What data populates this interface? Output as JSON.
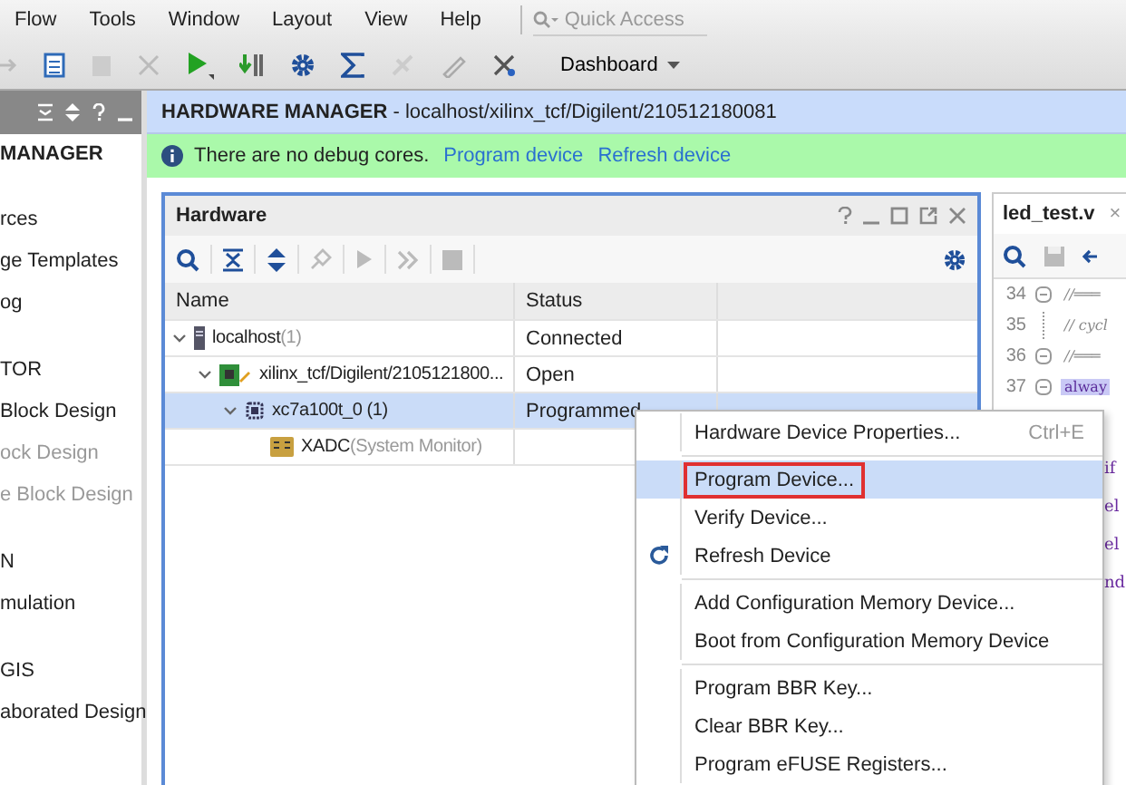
{
  "menu_bar": {
    "items": [
      "Flow",
      "Tools",
      "Window",
      "Layout",
      "View",
      "Help"
    ],
    "search": {
      "placeholder": "Quick Access"
    }
  },
  "toolbar": {
    "layout_dropdown": "Dashboard"
  },
  "flow_navigator": {
    "items": [
      {
        "label": "MANAGER",
        "kind": "heading",
        "disabled": false
      },
      {
        "label": "rces",
        "kind": "item",
        "disabled": false
      },
      {
        "label": "ge Templates",
        "kind": "item",
        "disabled": false
      },
      {
        "label": "og",
        "kind": "item",
        "disabled": false
      },
      {
        "label": "TOR",
        "kind": "section",
        "disabled": false
      },
      {
        "label": "Block Design",
        "kind": "item",
        "disabled": false
      },
      {
        "label": "ock Design",
        "kind": "item",
        "disabled": true
      },
      {
        "label": "e Block Design",
        "kind": "item",
        "disabled": true
      },
      {
        "label": "N",
        "kind": "section",
        "disabled": false
      },
      {
        "label": "mulation",
        "kind": "item",
        "disabled": false
      },
      {
        "label": "GIS",
        "kind": "section",
        "disabled": false
      },
      {
        "label": "aborated Design",
        "kind": "item",
        "disabled": false
      }
    ]
  },
  "hardware_manager": {
    "title": "HARDWARE MANAGER",
    "path": "- localhost/xilinx_tcf/Digilent/210512180081",
    "info": {
      "message": "There are no debug cores.",
      "links": [
        "Program device",
        "Refresh device"
      ]
    }
  },
  "hardware_panel": {
    "title": "Hardware",
    "columns": [
      "Name",
      "Status"
    ],
    "rows": [
      {
        "kind": "server",
        "label": "localhost",
        "suffix": "(1)",
        "status": "Connected",
        "expanded": true,
        "selected": false,
        "children": [
          {
            "kind": "board",
            "label": "xilinx_tcf/Digilent/2105121800...",
            "status": "Open",
            "expanded": true,
            "selected": false,
            "children": [
              {
                "kind": "chip",
                "label": "xc7a100t_0 (1)",
                "status": "Programmed",
                "expanded": true,
                "selected": true,
                "children": [
                  {
                    "kind": "monitor",
                    "label": "XADC",
                    "suffix": "(System Monitor)",
                    "selected": false
                  }
                ]
              }
            ]
          }
        ]
      }
    ]
  },
  "editor": {
    "tab": "led_test.v",
    "close": "×",
    "lines": [
      {
        "number": "34",
        "code": "//═══",
        "fold": true,
        "highlighted": false
      },
      {
        "number": "35",
        "code": "// cycl",
        "fold": false,
        "highlighted": false
      },
      {
        "number": "36",
        "code": "//═══",
        "fold": true,
        "highlighted": false
      },
      {
        "number": "37",
        "code": "alway",
        "fold": true,
        "highlighted": true
      }
    ],
    "fragments": [
      "if",
      "el",
      "el",
      "nd"
    ]
  },
  "context_menu": {
    "items": [
      {
        "kind": "item",
        "label": "Hardware Device Properties...",
        "shortcut": "Ctrl+E",
        "selected": false,
        "outlined": false
      },
      {
        "kind": "separator"
      },
      {
        "kind": "item",
        "label": "Program Device...",
        "selected": true,
        "outlined": true
      },
      {
        "kind": "item",
        "label": "Verify Device...",
        "selected": false,
        "outlined": false
      },
      {
        "kind": "refresh",
        "label": "Refresh Device",
        "selected": false,
        "outlined": false
      },
      {
        "kind": "separator"
      },
      {
        "kind": "item",
        "label": "Add Configuration Memory Device...",
        "selected": false,
        "outlined": false
      },
      {
        "kind": "item",
        "label": "Boot from Configuration Memory Device",
        "selected": false,
        "outlined": false
      },
      {
        "kind": "separator"
      },
      {
        "kind": "item",
        "label": "Program BBR Key...",
        "selected": false,
        "outlined": false
      },
      {
        "kind": "item",
        "label": "Clear BBR Key...",
        "selected": false,
        "outlined": false
      },
      {
        "kind": "item",
        "label": "Program eFUSE Registers...",
        "selected": false,
        "outlined": false
      }
    ]
  }
}
